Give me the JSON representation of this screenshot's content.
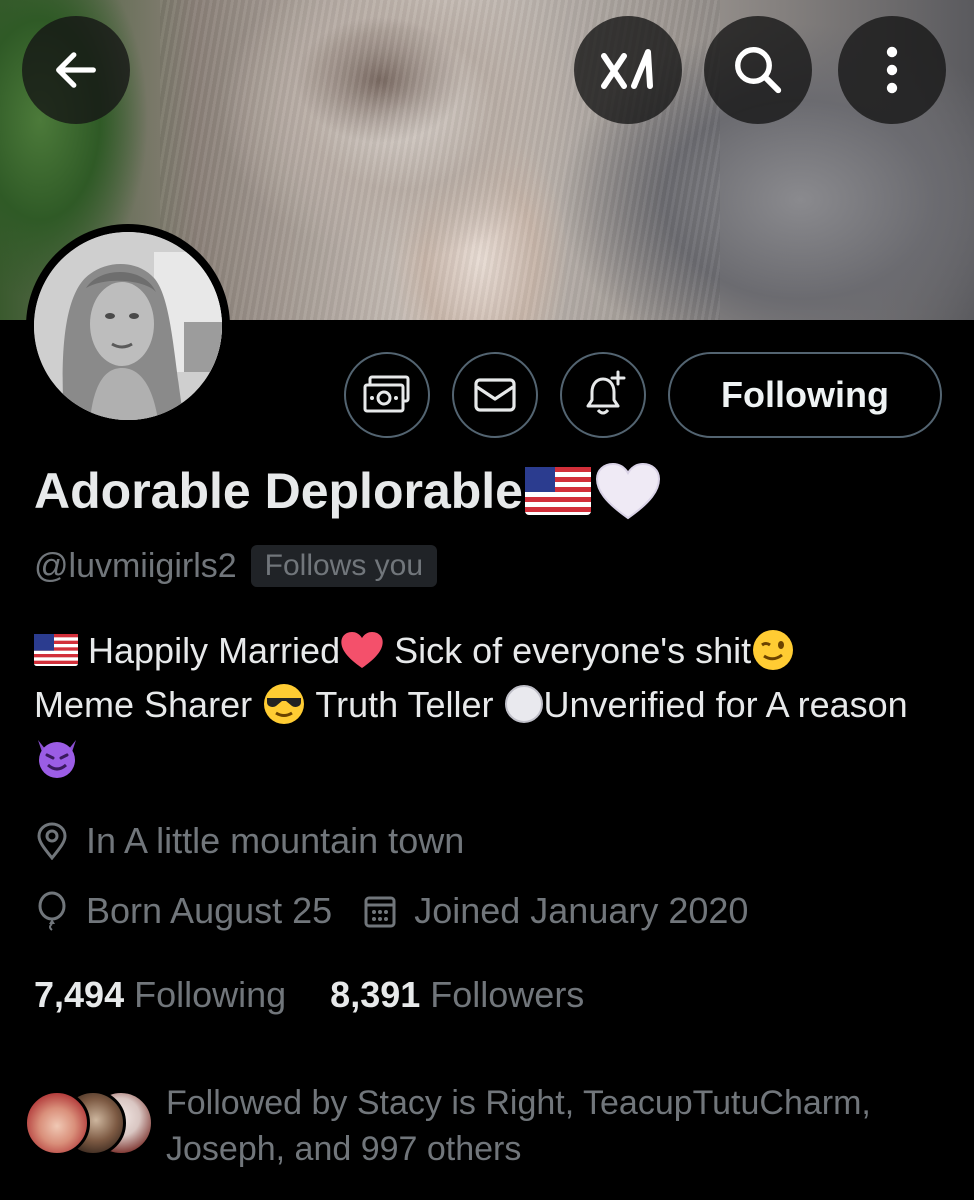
{
  "header": {
    "back_icon": "arrow-left-icon",
    "grok_icon": "grok-logo-icon",
    "search_icon": "search-icon",
    "more_icon": "more-vertical-icon"
  },
  "actions": {
    "tip_icon": "money-icon",
    "message_icon": "envelope-icon",
    "notify_icon": "bell-plus-icon",
    "following_label": "Following"
  },
  "profile": {
    "display_name": "Adorable Deplorable",
    "handle": "@luvmiigirls2",
    "follows_you_label": "Follows you",
    "bio": {
      "part1": " Happily Married",
      "part2": " Sick of everyone's shit",
      "part3": "Meme Sharer ",
      "part4": " Truth Teller ",
      "part5": "Unverified for A reason "
    },
    "location": "In A little mountain town",
    "birthday": "Born August 25",
    "joined": "Joined January 2020"
  },
  "stats": {
    "following_count": "7,494",
    "following_label": "Following",
    "followers_count": "8,391",
    "followers_label": "Followers"
  },
  "followed_by": {
    "text": "Followed by Stacy is Right, TeacupTutuCharm, Joseph, and 997 others"
  },
  "colors": {
    "background": "#000000",
    "primary_text": "#e7e9ea",
    "secondary_text": "#71767b",
    "border": "#536471"
  }
}
